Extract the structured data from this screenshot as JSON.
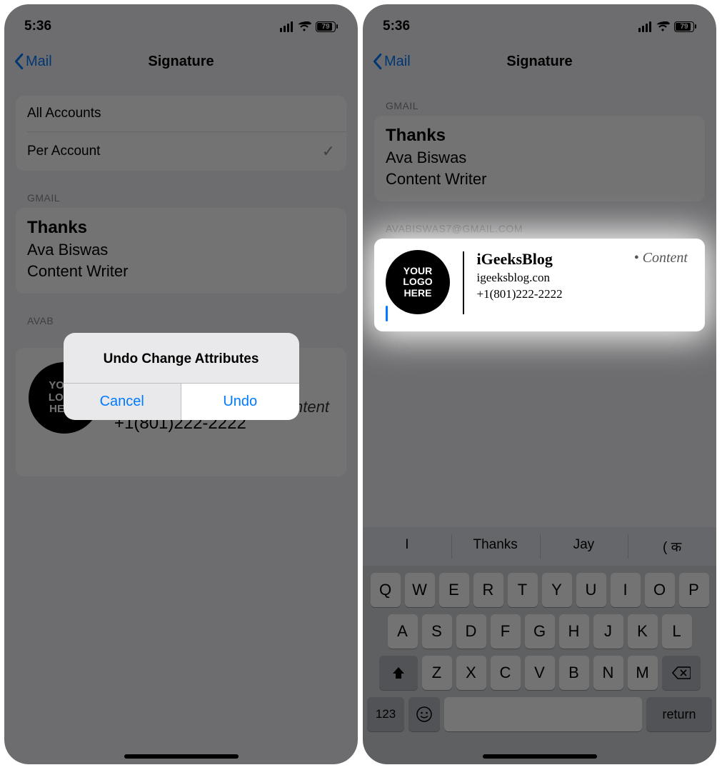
{
  "status": {
    "time": "5:36",
    "battery": "79"
  },
  "nav": {
    "back": "Mail",
    "title": "Signature"
  },
  "left": {
    "rows": {
      "all": "All Accounts",
      "per": "Per Account"
    },
    "group1_header": "GMAIL",
    "sig": {
      "thanks": "Thanks",
      "name": "Ava Biswas",
      "role": "Content Writer"
    },
    "group2_header": "AVAB",
    "rich": {
      "logo": "YOUR\nLOGO\nHERE",
      "title": "iGeeksBlog",
      "site": "igeeksblog.con",
      "phone": "+1(801)222-2222",
      "content_label": "Content"
    },
    "alert": {
      "title": "Undo Change Attributes",
      "cancel": "Cancel",
      "undo": "Undo"
    }
  },
  "right": {
    "group1_header": "GMAIL",
    "sig": {
      "thanks": "Thanks",
      "name": "Ava Biswas",
      "role": "Content Writer"
    },
    "group2_header": "AVABISWAS7@GMAIL.COM",
    "rich": {
      "logo": "YOUR\nLOGO\nHERE",
      "title": "iGeeksBlog",
      "site": "igeeksblog.con",
      "phone": "+1(801)222-2222",
      "content_label": "• Content"
    },
    "keyboard": {
      "sugg": [
        "I",
        "Thanks",
        "Jay",
        "( क"
      ],
      "row1": [
        "Q",
        "W",
        "E",
        "R",
        "T",
        "Y",
        "U",
        "I",
        "O",
        "P"
      ],
      "row2": [
        "A",
        "S",
        "D",
        "F",
        "G",
        "H",
        "J",
        "K",
        "L"
      ],
      "row3": [
        "Z",
        "X",
        "C",
        "V",
        "B",
        "N",
        "M"
      ],
      "numkey": "123",
      "return": "return"
    }
  }
}
